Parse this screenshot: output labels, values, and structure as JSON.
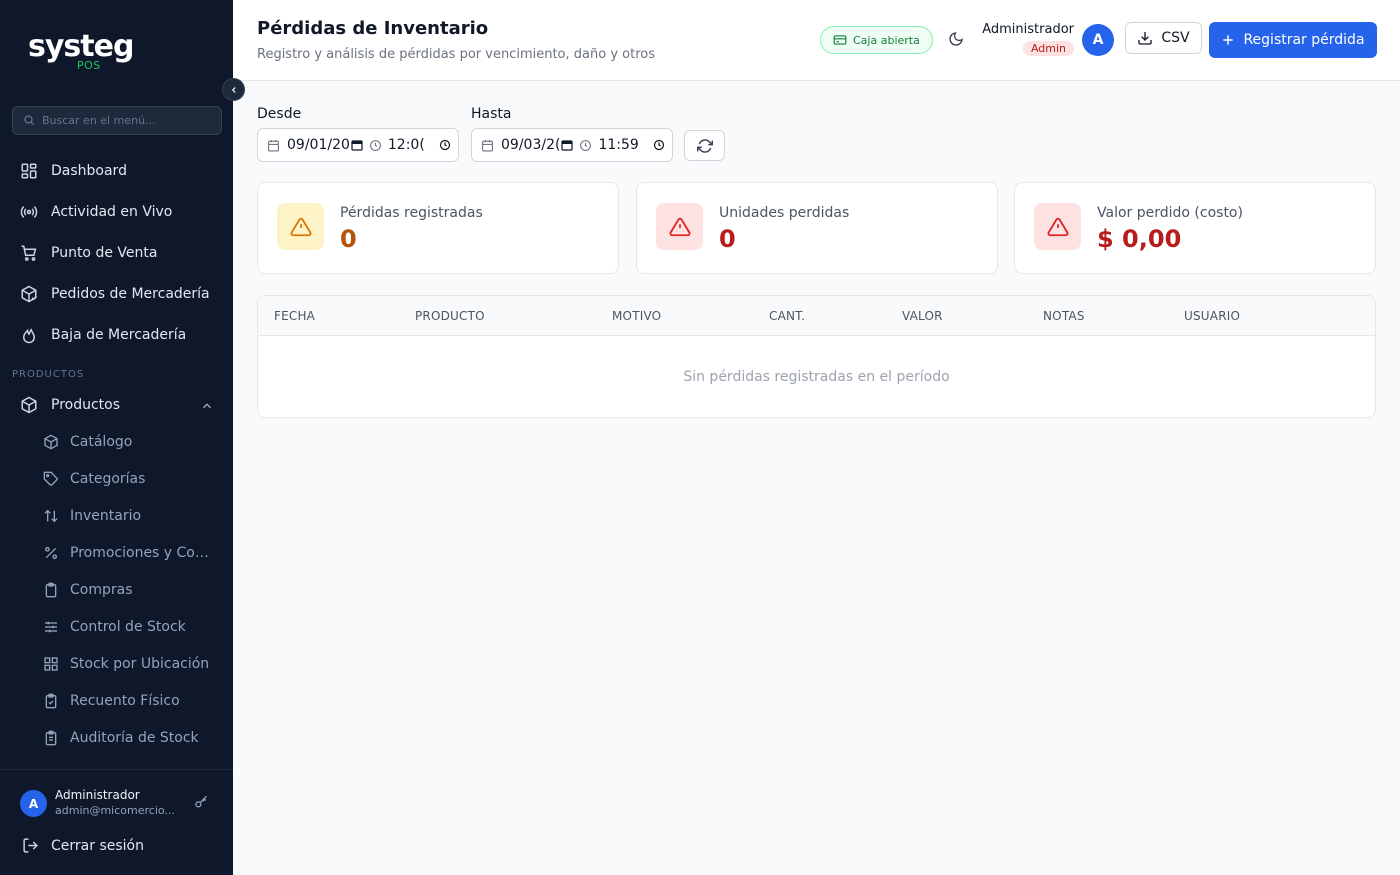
{
  "sidebar": {
    "logo_text": "systeg",
    "logo_sub": "POS",
    "search_placeholder": "Buscar en el menú...",
    "main_items": [
      {
        "label": "Dashboard",
        "icon": "dashboard-grid-icon"
      },
      {
        "label": "Actividad en Vivo",
        "icon": "live-broadcast-icon"
      },
      {
        "label": "Punto de Venta",
        "icon": "shopping-cart-icon"
      },
      {
        "label": "Pedidos de Mercadería",
        "icon": "package-order-icon"
      },
      {
        "label": "Baja de Mercadería",
        "icon": "flame-icon"
      }
    ],
    "section_label": "PRODUCTOS",
    "group": {
      "label": "Productos",
      "icon": "box-icon",
      "expanded": true
    },
    "sub_items": [
      {
        "label": "Catálogo",
        "icon": "cube-icon"
      },
      {
        "label": "Categorías",
        "icon": "tag-icon"
      },
      {
        "label": "Inventario",
        "icon": "sort-arrows-icon"
      },
      {
        "label": "Promociones y Com...",
        "icon": "percent-icon"
      },
      {
        "label": "Compras",
        "icon": "clipboard-icon"
      },
      {
        "label": "Control de Stock",
        "icon": "sliders-icon"
      },
      {
        "label": "Stock por Ubicación",
        "icon": "grid-icon"
      },
      {
        "label": "Recuento Físico",
        "icon": "clipboard-check-icon"
      },
      {
        "label": "Auditoría de Stock",
        "icon": "clipboard-list-icon"
      }
    ],
    "footer": {
      "avatar_initial": "A",
      "user_name": "Administrador",
      "user_email": "admin@micomercio...",
      "logout_label": "Cerrar sesión"
    }
  },
  "header": {
    "title": "Pérdidas de Inventario",
    "subtitle": "Registro y análisis de pérdidas por vencimiento, daño y otros",
    "caja_badge": "Caja abierta",
    "user_name": "Administrador",
    "user_role": "Admin",
    "avatar_initial": "A",
    "csv_label": "CSV",
    "register_label": "Registrar pérdida"
  },
  "filters": {
    "desde_label": "Desde",
    "desde_value": "09/01/20",
    "desde_time": "12:0(",
    "hasta_label": "Hasta",
    "hasta_value": "09/03/2(",
    "hasta_time": "11:59"
  },
  "stats": [
    {
      "label": "Pérdidas registradas",
      "value": "0",
      "color": "#b45309",
      "icon_bg": "#fef3c7",
      "icon_color": "#d97706"
    },
    {
      "label": "Unidades perdidas",
      "value": "0",
      "color": "#b91c1c",
      "icon_bg": "#fee2e2",
      "icon_color": "#dc2626"
    },
    {
      "label": "Valor perdido (costo)",
      "value": "$ 0,00",
      "color": "#b91c1c",
      "icon_bg": "#fee2e2",
      "icon_color": "#dc2626"
    }
  ],
  "table": {
    "columns": [
      "FECHA",
      "PRODUCTO",
      "MOTIVO",
      "CANT.",
      "VALOR",
      "NOTAS",
      "USUARIO"
    ],
    "empty_message": "Sin pérdidas registradas en el período"
  }
}
